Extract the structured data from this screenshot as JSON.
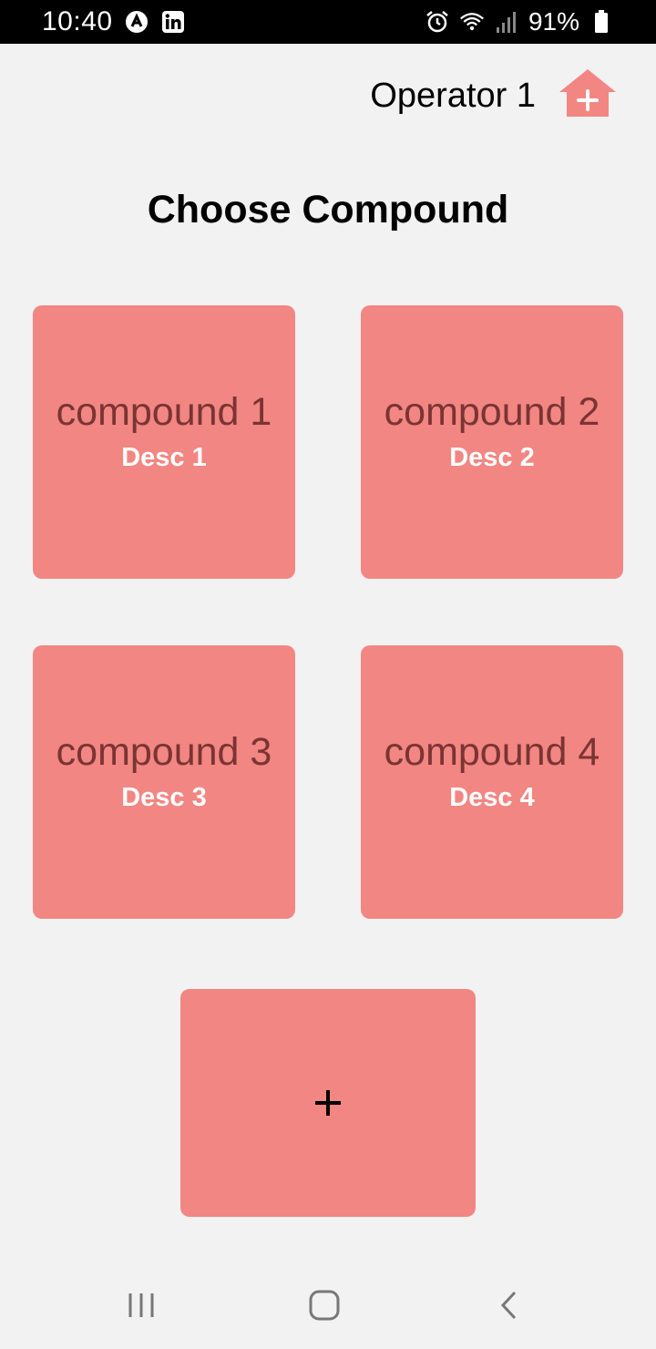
{
  "status_bar": {
    "time": "10:40",
    "left_icons": [
      "android-icon",
      "linkedin-icon"
    ],
    "right_icons": [
      "alarm-icon",
      "wifi-icon",
      "signal-icon",
      "battery-icon"
    ],
    "battery_percent": "91%"
  },
  "header": {
    "operator": "Operator 1",
    "action_icon": "home-add-icon"
  },
  "page": {
    "title": "Choose Compound"
  },
  "compounds": [
    {
      "name": "compound 1",
      "desc": "Desc 1"
    },
    {
      "name": "compound 2",
      "desc": "Desc 2"
    },
    {
      "name": "compound 3",
      "desc": "Desc 3"
    },
    {
      "name": "compound 4",
      "desc": "Desc 4"
    }
  ],
  "add_button": {
    "icon": "plus-icon"
  },
  "colors": {
    "tile": "#f28682",
    "tile_name": "#7a3433",
    "background": "#f2f2f2"
  },
  "nav_bar": {
    "buttons": [
      "recents-icon",
      "home-icon",
      "back-icon"
    ]
  }
}
